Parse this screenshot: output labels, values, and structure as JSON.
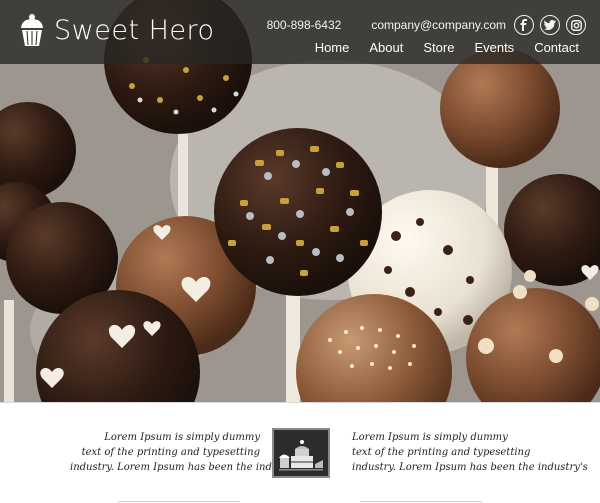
{
  "header": {
    "brand": "Sweet Hero",
    "phone": "800-898-6432",
    "email": "company@company.com",
    "social": [
      {
        "name": "facebook-icon",
        "glyph": "f"
      },
      {
        "name": "twitter-icon",
        "glyph": "t"
      },
      {
        "name": "instagram-icon",
        "glyph": "ig"
      }
    ]
  },
  "nav": {
    "items": [
      {
        "label": "Home"
      },
      {
        "label": "About"
      },
      {
        "label": "Store"
      },
      {
        "label": "Events"
      },
      {
        "label": "Contact"
      }
    ]
  },
  "hero": {
    "image": "chocolate-cake-pops-photo"
  },
  "strip": {
    "left_lines": [
      "Lorem Ipsum is simply dummy",
      "text of the printing and typesetting",
      "industry. Lorem Ipsum has been the industry's"
    ],
    "right_lines": [
      "Lorem Ipsum is simply dummy",
      "text of the printing and typesetting",
      "industry. Lorem Ipsum has been the industry's"
    ],
    "badge_icon": "bakery-cakes-icon"
  },
  "colors": {
    "topbar": "#282624",
    "nav_text": "#ffffff",
    "strip_bg": "#ffffff",
    "chocolate": "#3b2417"
  }
}
